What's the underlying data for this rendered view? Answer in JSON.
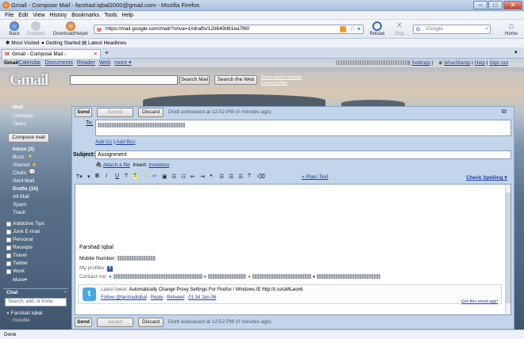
{
  "window": {
    "title": "Gmail - Compose Mail - farshad.iqbal2000@gmail.com - Mozilla Firefox"
  },
  "menu": [
    "File",
    "Edit",
    "View",
    "History",
    "Bookmarks",
    "Tools",
    "Help"
  ],
  "nav": {
    "back": "Back",
    "forward": "Forward",
    "download": "DownloadHelper",
    "reload": "Reload",
    "stop": "Stop",
    "home": "Home"
  },
  "url": "https://mail.google.com/mail/?shva=1#drafts/12d649d61ea7f80",
  "search_placeholder": "Google",
  "bookmarks": [
    "Most Visited",
    "Getting Started",
    "Latest Headlines"
  ],
  "tab_title": "Gmail - Compose Mail - farshad.iqbal...",
  "gbar": {
    "items": [
      "Gmail",
      "Calendar",
      "Documents",
      "Reader",
      "Web",
      "more ▾"
    ],
    "right": [
      "Settings",
      "WiseStamp",
      "Help",
      "Sign out"
    ]
  },
  "logo": "Gmail",
  "mail_search": {
    "search_mail": "Search Mail",
    "search_web": "Search the Web",
    "show_options": "Show search options",
    "create_filter": "Create a filter"
  },
  "sidebar": {
    "mail": "Mail",
    "contacts": "Contacts",
    "tasks": "Tasks",
    "compose": "Compose mail",
    "folders": [
      {
        "label": "Inbox (3)",
        "bold": true
      },
      {
        "label": "Buzz",
        "bold": false
      },
      {
        "label": "Starred",
        "bold": false
      },
      {
        "label": "Chats",
        "bold": false
      },
      {
        "label": "Sent Mail",
        "bold": false
      },
      {
        "label": "Drafts (10)",
        "bold": true
      },
      {
        "label": "All Mail",
        "bold": false
      },
      {
        "label": "Spam",
        "bold": false
      },
      {
        "label": "Trash",
        "bold": false
      }
    ],
    "labels": [
      "Addictive Tips",
      "Junk E-mail",
      "Personal",
      "Receipts",
      "Travel",
      "Twitter",
      "Work"
    ],
    "more": "More▾",
    "chat_title": "Chat",
    "chat_search_placeholder": "Search, add, or invite",
    "chat_user": "Farshad Iqbal",
    "chat_status": "Invisible"
  },
  "compose": {
    "send": "Send",
    "saved": "Saved",
    "discard": "Discard",
    "autosave": "Draft autosaved at 12:52 PM (0 minutes ago)",
    "to_label": "To:",
    "add_cc": "Add Cc",
    "add_bcc": "Add Bcc",
    "subject_label": "Subject:",
    "subject_value": "Assignment",
    "attach": "Attach a file",
    "insert": "Insert:",
    "invitation": "Invitation",
    "plain_text": "« Plain Text",
    "spelling": "Check Spelling ▾"
  },
  "signature": {
    "name": "Farshad Iqbal",
    "mobile_label": "Mobile Number:",
    "profiles_label": "My profiles:",
    "contact_label": "Contact me:",
    "tweet_prefix": "Latest tweet:",
    "tweet": "Automatically Change Proxy Settings For Firefox / Windows IE http://t.co/uMLaon6",
    "follow": "Follow @farshadiqbal",
    "reply": "Reply",
    "retweet": "Retweet",
    "time": "01:34 Jan-06",
    "get_app": "Get this email app!"
  },
  "status": "Done"
}
